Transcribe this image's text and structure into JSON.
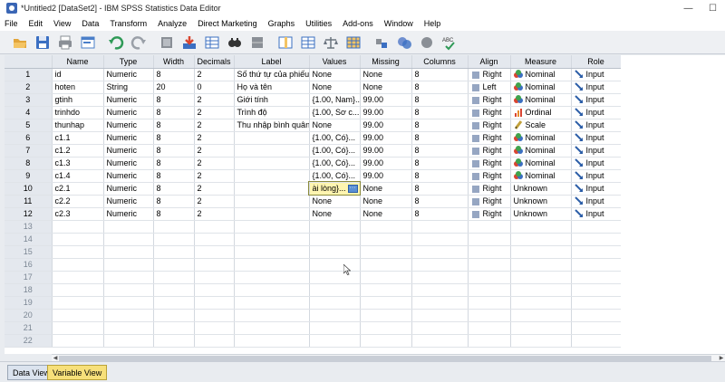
{
  "window": {
    "title": "*Untitled2 [DataSet2] - IBM SPSS Statistics Data Editor",
    "minimize": "—",
    "maximize": "☐"
  },
  "menu": [
    "File",
    "Edit",
    "View",
    "Data",
    "Transform",
    "Analyze",
    "Direct Marketing",
    "Graphs",
    "Utilities",
    "Add-ons",
    "Window",
    "Help"
  ],
  "toolbar": [
    {
      "name": "open-icon",
      "color": "#e2a53a"
    },
    {
      "name": "save-icon",
      "color": "#3b6fc2"
    },
    {
      "name": "print-icon",
      "color": "#8a8f96"
    },
    {
      "name": "dialog-recall-icon",
      "color": "#4b7fc9"
    },
    {
      "name": "undo-icon",
      "color": "#2f9a57"
    },
    {
      "name": "redo-icon",
      "color": "#9aa0a8"
    },
    {
      "name": "goto-case-icon",
      "color": "#8a8f96"
    },
    {
      "name": "goto-variable-icon",
      "color": "#d9452f"
    },
    {
      "name": "variables-icon",
      "color": "#3b6fc2"
    },
    {
      "name": "find-icon",
      "color": "#333333"
    },
    {
      "name": "insert-cases-icon",
      "color": "#8a8f96"
    },
    {
      "name": "insert-variable-icon",
      "color": "#3b6fc2"
    },
    {
      "name": "split-file-icon",
      "color": "#3b6fc2"
    },
    {
      "name": "weight-cases-icon",
      "color": "#6b7580"
    },
    {
      "name": "select-cases-icon",
      "color": "#3b6fc2"
    },
    {
      "name": "value-labels-icon",
      "color": "#8a8f96"
    },
    {
      "name": "use-variable-sets-icon",
      "color": "#6f8fd0"
    },
    {
      "name": "show-all-variables-icon",
      "color": "#8a8f96"
    },
    {
      "name": "spell-check-icon",
      "color": "#2f9a57"
    }
  ],
  "grid": {
    "headers": [
      "",
      "Name",
      "Type",
      "Width",
      "Decimals",
      "Label",
      "Values",
      "Missing",
      "Columns",
      "Align",
      "Measure",
      "Role"
    ],
    "rows": [
      {
        "num": "1",
        "name": "id",
        "type": "Numeric",
        "width": "8",
        "decimals": "2",
        "label": "Số thứ tự của phiếu",
        "values": "None",
        "missing": "None",
        "columns": "8",
        "align": "Right",
        "measure": "Nominal",
        "role": "Input"
      },
      {
        "num": "2",
        "name": "hoten",
        "type": "String",
        "width": "20",
        "decimals": "0",
        "label": "Họ và tên",
        "values": "None",
        "missing": "None",
        "columns": "8",
        "align": "Left",
        "measure": "Nominal",
        "role": "Input"
      },
      {
        "num": "3",
        "name": "gtinh",
        "type": "Numeric",
        "width": "8",
        "decimals": "2",
        "label": "Giới tính",
        "values": "{1.00, Nam}...",
        "missing": "99.00",
        "columns": "8",
        "align": "Right",
        "measure": "Nominal",
        "role": "Input"
      },
      {
        "num": "4",
        "name": "trinhdo",
        "type": "Numeric",
        "width": "8",
        "decimals": "2",
        "label": "Trình độ",
        "values": "{1.00, Sơ c...",
        "missing": "99.00",
        "columns": "8",
        "align": "Right",
        "measure": "Ordinal",
        "role": "Input"
      },
      {
        "num": "5",
        "name": "thunhap",
        "type": "Numeric",
        "width": "8",
        "decimals": "2",
        "label": "Thu nhập bình quân...",
        "values": "None",
        "missing": "99.00",
        "columns": "8",
        "align": "Right",
        "measure": "Scale",
        "role": "Input"
      },
      {
        "num": "6",
        "name": "c1.1",
        "type": "Numeric",
        "width": "8",
        "decimals": "2",
        "label": "",
        "values": "{1.00, Có}...",
        "missing": "99.00",
        "columns": "8",
        "align": "Right",
        "measure": "Nominal",
        "role": "Input"
      },
      {
        "num": "7",
        "name": "c1.2",
        "type": "Numeric",
        "width": "8",
        "decimals": "2",
        "label": "",
        "values": "{1.00, Có}...",
        "missing": "99.00",
        "columns": "8",
        "align": "Right",
        "measure": "Nominal",
        "role": "Input"
      },
      {
        "num": "8",
        "name": "c1.3",
        "type": "Numeric",
        "width": "8",
        "decimals": "2",
        "label": "",
        "values": "{1.00, Có}...",
        "missing": "99.00",
        "columns": "8",
        "align": "Right",
        "measure": "Nominal",
        "role": "Input"
      },
      {
        "num": "9",
        "name": "c1.4",
        "type": "Numeric",
        "width": "8",
        "decimals": "2",
        "label": "",
        "values": "{1.00, Có}...",
        "missing": "99.00",
        "columns": "8",
        "align": "Right",
        "measure": "Nominal",
        "role": "Input"
      },
      {
        "num": "10",
        "name": "c2.1",
        "type": "Numeric",
        "width": "8",
        "decimals": "2",
        "label": "",
        "values": "ài lòng}...",
        "missing": "None",
        "columns": "8",
        "align": "Right",
        "measure": "Unknown",
        "role": "Input",
        "editing": true
      },
      {
        "num": "11",
        "name": "c2.2",
        "type": "Numeric",
        "width": "8",
        "decimals": "2",
        "label": "",
        "values": "None",
        "missing": "None",
        "columns": "8",
        "align": "Right",
        "measure": "Unknown",
        "role": "Input"
      },
      {
        "num": "12",
        "name": "c2.3",
        "type": "Numeric",
        "width": "8",
        "decimals": "2",
        "label": "",
        "values": "None",
        "missing": "None",
        "columns": "8",
        "align": "Right",
        "measure": "Unknown",
        "role": "Input"
      }
    ],
    "empty_rows": [
      "13",
      "14",
      "15",
      "16",
      "17",
      "18",
      "19",
      "20",
      "21",
      "22"
    ]
  },
  "tabs": {
    "data_view": "Data View",
    "variable_view": "Variable View"
  },
  "colors": {
    "active_tab": "#f7e07a",
    "header_bg": "#e4e8ee",
    "edit_cell": "#fff5b0"
  }
}
